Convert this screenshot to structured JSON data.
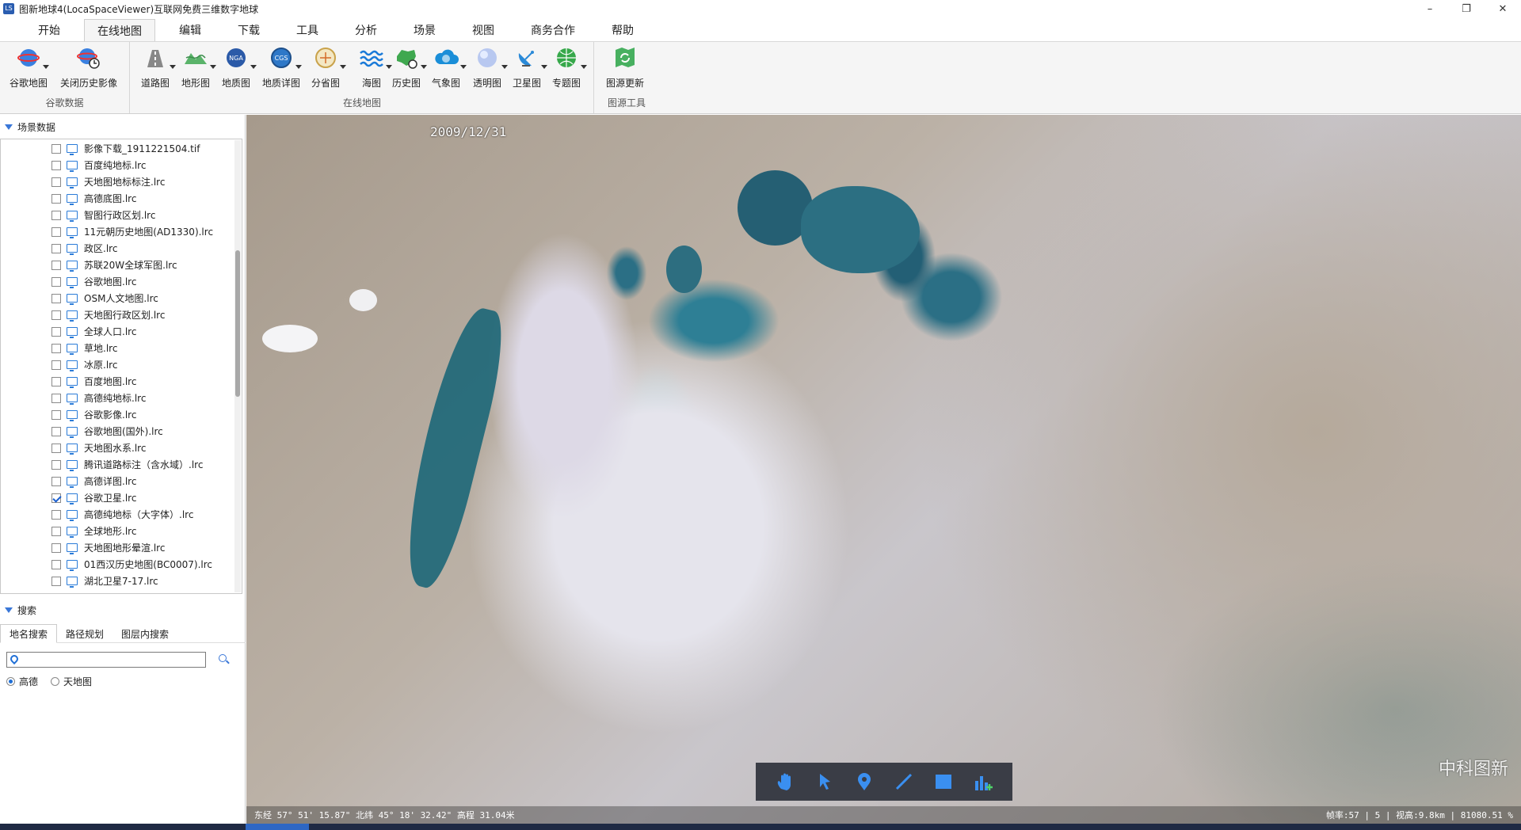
{
  "window": {
    "title": "图新地球4(LocaSpaceViewer)互联网免费三维数字地球",
    "app_icon_text": "LS"
  },
  "menu": [
    "开始",
    "在线地图",
    "编辑",
    "下载",
    "工具",
    "分析",
    "场景",
    "视图",
    "商务合作",
    "帮助"
  ],
  "menu_active": "在线地图",
  "ribbon": {
    "groups": [
      {
        "label": "谷歌数据",
        "tools": [
          "谷歌地图",
          "关闭历史影像"
        ]
      },
      {
        "label": "在线地图",
        "tools": [
          "道路图",
          "地形图",
          "地质图",
          "地质详图",
          "分省图",
          "海图",
          "历史图",
          "气象图",
          "透明图",
          "卫星图",
          "专题图"
        ]
      },
      {
        "label": "图源工具",
        "tools": [
          "图源更新"
        ]
      }
    ]
  },
  "left_panel": {
    "scene_header": "场景数据",
    "tree_items": [
      {
        "label": "影像下载_1911221504.tif",
        "checked": false
      },
      {
        "label": "百度纯地标.lrc",
        "checked": false
      },
      {
        "label": "天地图地标标注.lrc",
        "checked": false
      },
      {
        "label": "高德底图.lrc",
        "checked": false
      },
      {
        "label": "智图行政区划.lrc",
        "checked": false
      },
      {
        "label": "11元朝历史地图(AD1330).lrc",
        "checked": false
      },
      {
        "label": "政区.lrc",
        "checked": false
      },
      {
        "label": "苏联20W全球军图.lrc",
        "checked": false
      },
      {
        "label": "谷歌地图.lrc",
        "checked": false
      },
      {
        "label": "OSM人文地图.lrc",
        "checked": false
      },
      {
        "label": "天地图行政区划.lrc",
        "checked": false
      },
      {
        "label": "全球人口.lrc",
        "checked": false
      },
      {
        "label": "草地.lrc",
        "checked": false
      },
      {
        "label": "冰原.lrc",
        "checked": false
      },
      {
        "label": "百度地图.lrc",
        "checked": false
      },
      {
        "label": "高德纯地标.lrc",
        "checked": false
      },
      {
        "label": "谷歌影像.lrc",
        "checked": false
      },
      {
        "label": "谷歌地图(国外).lrc",
        "checked": false
      },
      {
        "label": "天地图水系.lrc",
        "checked": false
      },
      {
        "label": "腾讯道路标注（含水域）.lrc",
        "checked": false
      },
      {
        "label": "高德详图.lrc",
        "checked": false
      },
      {
        "label": "谷歌卫星.lrc",
        "checked": true
      },
      {
        "label": "高德纯地标（大字体）.lrc",
        "checked": false
      },
      {
        "label": "全球地形.lrc",
        "checked": false
      },
      {
        "label": "天地图地形晕渲.lrc",
        "checked": false
      },
      {
        "label": "01西汉历史地图(BC0007).lrc",
        "checked": false
      },
      {
        "label": "湖北卫星7-17.lrc",
        "checked": false
      }
    ],
    "search_header": "搜索",
    "search_tabs": [
      "地名搜索",
      "路径规划",
      "图层内搜索"
    ],
    "search_tab_active": "地名搜索",
    "search_value": "",
    "radio_options": [
      "高德",
      "天地图"
    ],
    "radio_selected": "高德"
  },
  "map": {
    "date": "2009/12/31",
    "watermark": "中科图新",
    "tools": [
      "hand-icon",
      "pointer-icon",
      "pin-icon",
      "line-icon",
      "rectangle-icon",
      "chart-add-icon"
    ],
    "status_left": "东经 57° 51' 15.87\"  北纬 45° 18' 32.42\"  高程 31.04米",
    "status_right": "帧率:57 | 5 | 视高:9.8km | 81080.51 %"
  }
}
